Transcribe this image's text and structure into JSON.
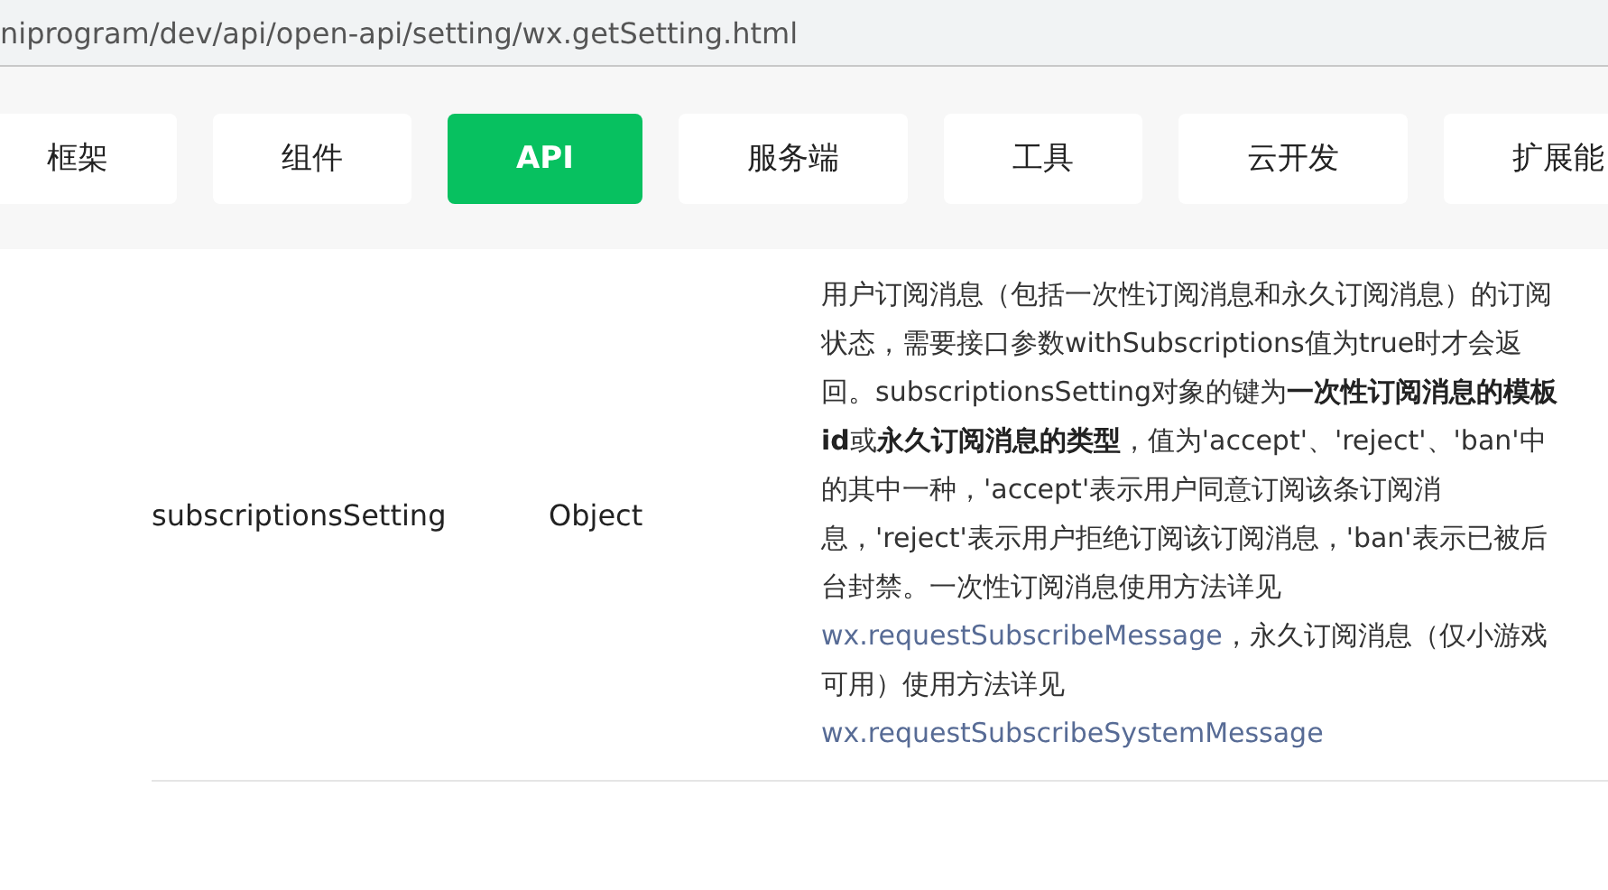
{
  "address_bar": {
    "url": "niprogram/dev/api/open-api/setting/wx.getSetting.html"
  },
  "nav_tabs": [
    {
      "label": "框架",
      "selected": false
    },
    {
      "label": "组件",
      "selected": false
    },
    {
      "label": "API",
      "selected": true
    },
    {
      "label": "服务端",
      "selected": false
    },
    {
      "label": "工具",
      "selected": false
    },
    {
      "label": "云开发",
      "selected": false
    },
    {
      "label": "扩展能",
      "selected": false
    }
  ],
  "table": {
    "rows": [
      {
        "name": "subscriptionsSetting",
        "type": "Object",
        "description": [
          {
            "kind": "text",
            "text": "用户订阅消息（包括一次性订阅消息和永久订阅消息）的订阅状态，需要接口参数withSubscriptions值为true时才会返回。subscriptionsSetting对象的键为**一次性订阅消息的模板id**或**永久订阅消息的类型**，值为'accept'、'reject'、'ban'中的其中一种，'accept'表示用户同意订阅该条订阅消息，'reject'表示用户拒绝订阅该订阅消息，'ban'表示已被后台封禁。一次性订阅消息使用方法详见"
          },
          {
            "kind": "link",
            "text": "wx.requestSubscribeMessage"
          },
          {
            "kind": "text",
            "text": "，永久订阅消息（仅小游戏可用）使用方法详见"
          },
          {
            "kind": "link",
            "text": "wx.requestSubscribeSystemMessage"
          }
        ]
      }
    ]
  }
}
